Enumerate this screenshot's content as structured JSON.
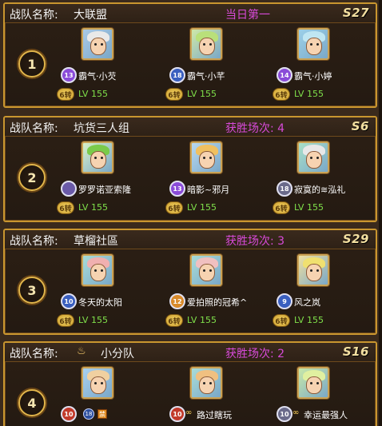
{
  "teams": [
    {
      "label": "战队名称:",
      "name": "大联盟",
      "status": "当日第一",
      "season": "S27",
      "rank": "1",
      "members": [
        {
          "name": "霸气·小芡",
          "level_badge": "13",
          "badge_color": "#8a4bd8",
          "trans": "6转",
          "lv": "LV 155",
          "hair": "#e9e9e9",
          "bg": "#a9c9e6"
        },
        {
          "name": "霸气·小芊",
          "level_badge": "18",
          "badge_color": "#3a5fbf",
          "trans": "6转",
          "lv": "LV 155",
          "hair": "#b9e07a",
          "bg": "#cfe8a8"
        },
        {
          "name": "霸气·小婷",
          "level_badge": "14",
          "badge_color": "#8a4bd8",
          "trans": "6转",
          "lv": "LV 155",
          "hair": "#bfe6f2",
          "bg": "#9cd0e8"
        }
      ]
    },
    {
      "label": "战队名称:",
      "name": "坑货三人组",
      "status": "获胜场次: 4",
      "season": "S6",
      "rank": "2",
      "members": [
        {
          "name": "罗罗诺亚索隆",
          "level_badge": "",
          "badge_color": "#6a5aa8",
          "trans": "6转",
          "lv": "LV 155",
          "hair": "#7acb4a",
          "bg": "#d8f0c8"
        },
        {
          "name": "暗影~邪月",
          "level_badge": "13",
          "badge_color": "#8a4bd8",
          "trans": "6转",
          "lv": "LV 155",
          "hair": "#f0c060",
          "bg": "#b8d8f0"
        },
        {
          "name": "寂寞的≋泓礼",
          "level_badge": "18",
          "badge_color": "#6a6a8a",
          "trans": "6转",
          "lv": "LV 155",
          "hair": "#e8e8e8",
          "bg": "#a8e0c8"
        }
      ]
    },
    {
      "label": "战队名称:",
      "name": "草榴社區",
      "status": "获胜场次: 3",
      "season": "S29",
      "rank": "3",
      "members": [
        {
          "name": "冬天的太阳",
          "level_badge": "10",
          "badge_color": "#3a5fbf",
          "trans": "6转",
          "lv": "LV 155",
          "hair": "#f0b0b0",
          "bg": "#a8dcd8"
        },
        {
          "name": "爱拍照的冠希^",
          "level_badge": "12",
          "badge_color": "#d88a2a",
          "trans": "6转",
          "lv": "LV 155",
          "hair": "#f0c0c0",
          "bg": "#a8dcd8"
        },
        {
          "name": "风之岚",
          "level_badge": "9",
          "badge_color": "#3a5fbf",
          "trans": "6转",
          "lv": "LV 155",
          "hair": "#f0e070",
          "bg": "#f0e0a0"
        }
      ]
    },
    {
      "label": "战队名称:",
      "name": "小分队",
      "status": "获胜场次: 2",
      "season": "S16",
      "rank": "4",
      "members": [
        {
          "name": "",
          "level_badge": "10",
          "badge_color": "#c23a2a",
          "trans": "",
          "lv": "",
          "hair": "#f0d0a0",
          "bg": "#a8d0f0",
          "extra_vip": "18",
          "tag": "禁"
        },
        {
          "name": "路过瞎玩",
          "level_badge": "10",
          "badge_color": "#c23a2a",
          "trans": "",
          "lv": "",
          "hair": "#f0c080",
          "bg": "#a8dcd8"
        },
        {
          "name": "幸运最强人",
          "level_badge": "10",
          "badge_color": "#6a6a8a",
          "trans": "",
          "lv": "",
          "hair": "#e0f0a0",
          "bg": "#c8e8a8"
        }
      ]
    }
  ]
}
